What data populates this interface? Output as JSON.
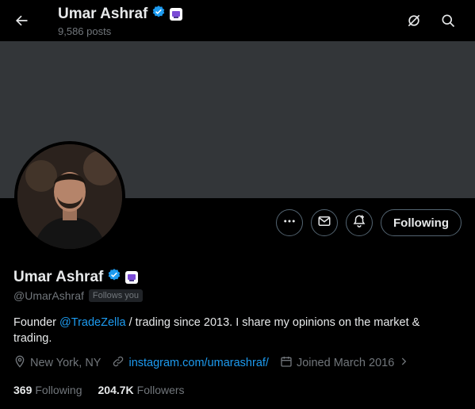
{
  "header": {
    "title": "Umar Ashraf",
    "post_count": "9,586 posts"
  },
  "profile": {
    "name": "Umar Ashraf",
    "handle": "@UmarAshraf",
    "follows_you": "Follows you",
    "bio_prefix": "Founder ",
    "bio_mention": "@TradeZella",
    "bio_suffix": " / trading since 2013. I share my opinions on the market & trading.",
    "location": "New York, NY",
    "website": "instagram.com/umarashraf/",
    "joined": "Joined March 2016",
    "following_count": "369",
    "following_label": "Following",
    "followers_count": "204.7K",
    "followers_label": "Followers"
  },
  "actions": {
    "follow_label": "Following",
    "more_icon": "more-icon",
    "message_icon": "message-icon",
    "notify_icon": "notification-bell-icon"
  },
  "colors": {
    "accent": "#1d9bf0",
    "verified": "#1d9bf0",
    "banner": "#333639"
  }
}
